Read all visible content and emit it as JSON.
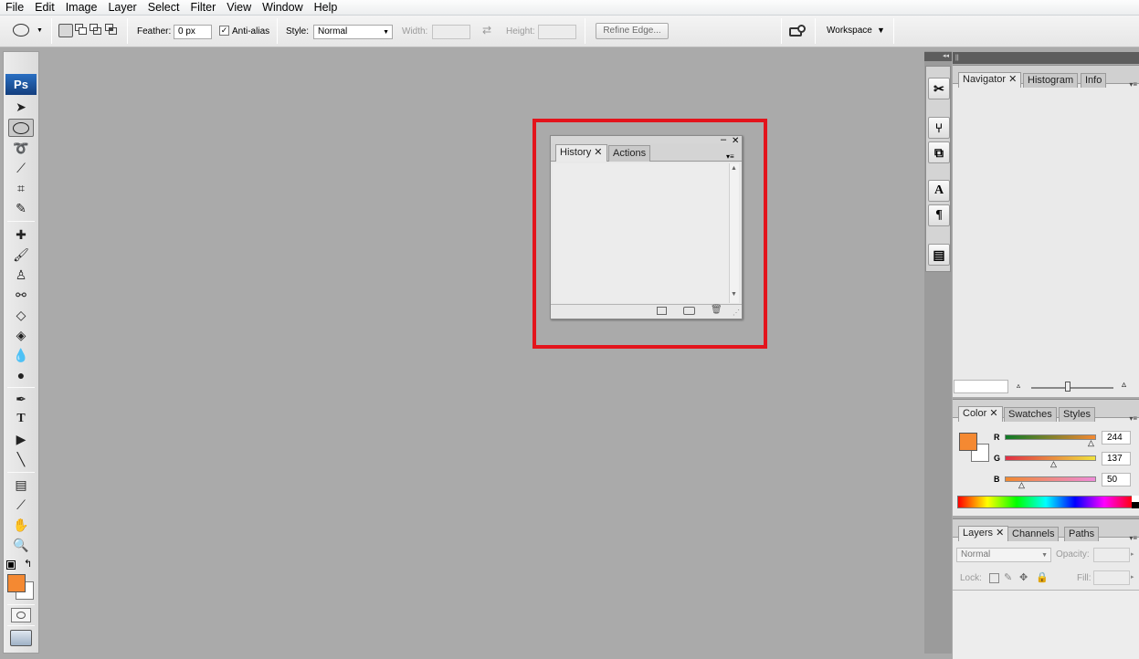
{
  "menu": [
    "File",
    "Edit",
    "Image",
    "Layer",
    "Select",
    "Filter",
    "View",
    "Window",
    "Help"
  ],
  "options": {
    "feather_label": "Feather:",
    "feather_value": "0 px",
    "antialias_label": "Anti-alias",
    "antialias_checked": true,
    "style_label": "Style:",
    "style_value": "Normal",
    "width_label": "Width:",
    "height_label": "Height:",
    "refine_edge": "Refine Edge...",
    "workspace": "Workspace"
  },
  "toolbox": {
    "logo": "Ps",
    "foreground_color": "#f48932",
    "background_color": "#ffffff"
  },
  "history_panel": {
    "tabs": [
      "History",
      "Actions"
    ],
    "highlight_color": "#e3141c"
  },
  "navigator_panel": {
    "tabs": [
      "Navigator",
      "Histogram",
      "Info"
    ]
  },
  "color_panel": {
    "tabs": [
      "Color",
      "Swatches",
      "Styles"
    ],
    "channels": [
      {
        "label": "R",
        "value": "244"
      },
      {
        "label": "G",
        "value": "137"
      },
      {
        "label": "B",
        "value": "50"
      }
    ]
  },
  "layers_panel": {
    "tabs": [
      "Layers",
      "Channels",
      "Paths"
    ],
    "blend_mode": "Normal",
    "opacity_label": "Opacity:",
    "lock_label": "Lock:",
    "fill_label": "Fill:"
  }
}
